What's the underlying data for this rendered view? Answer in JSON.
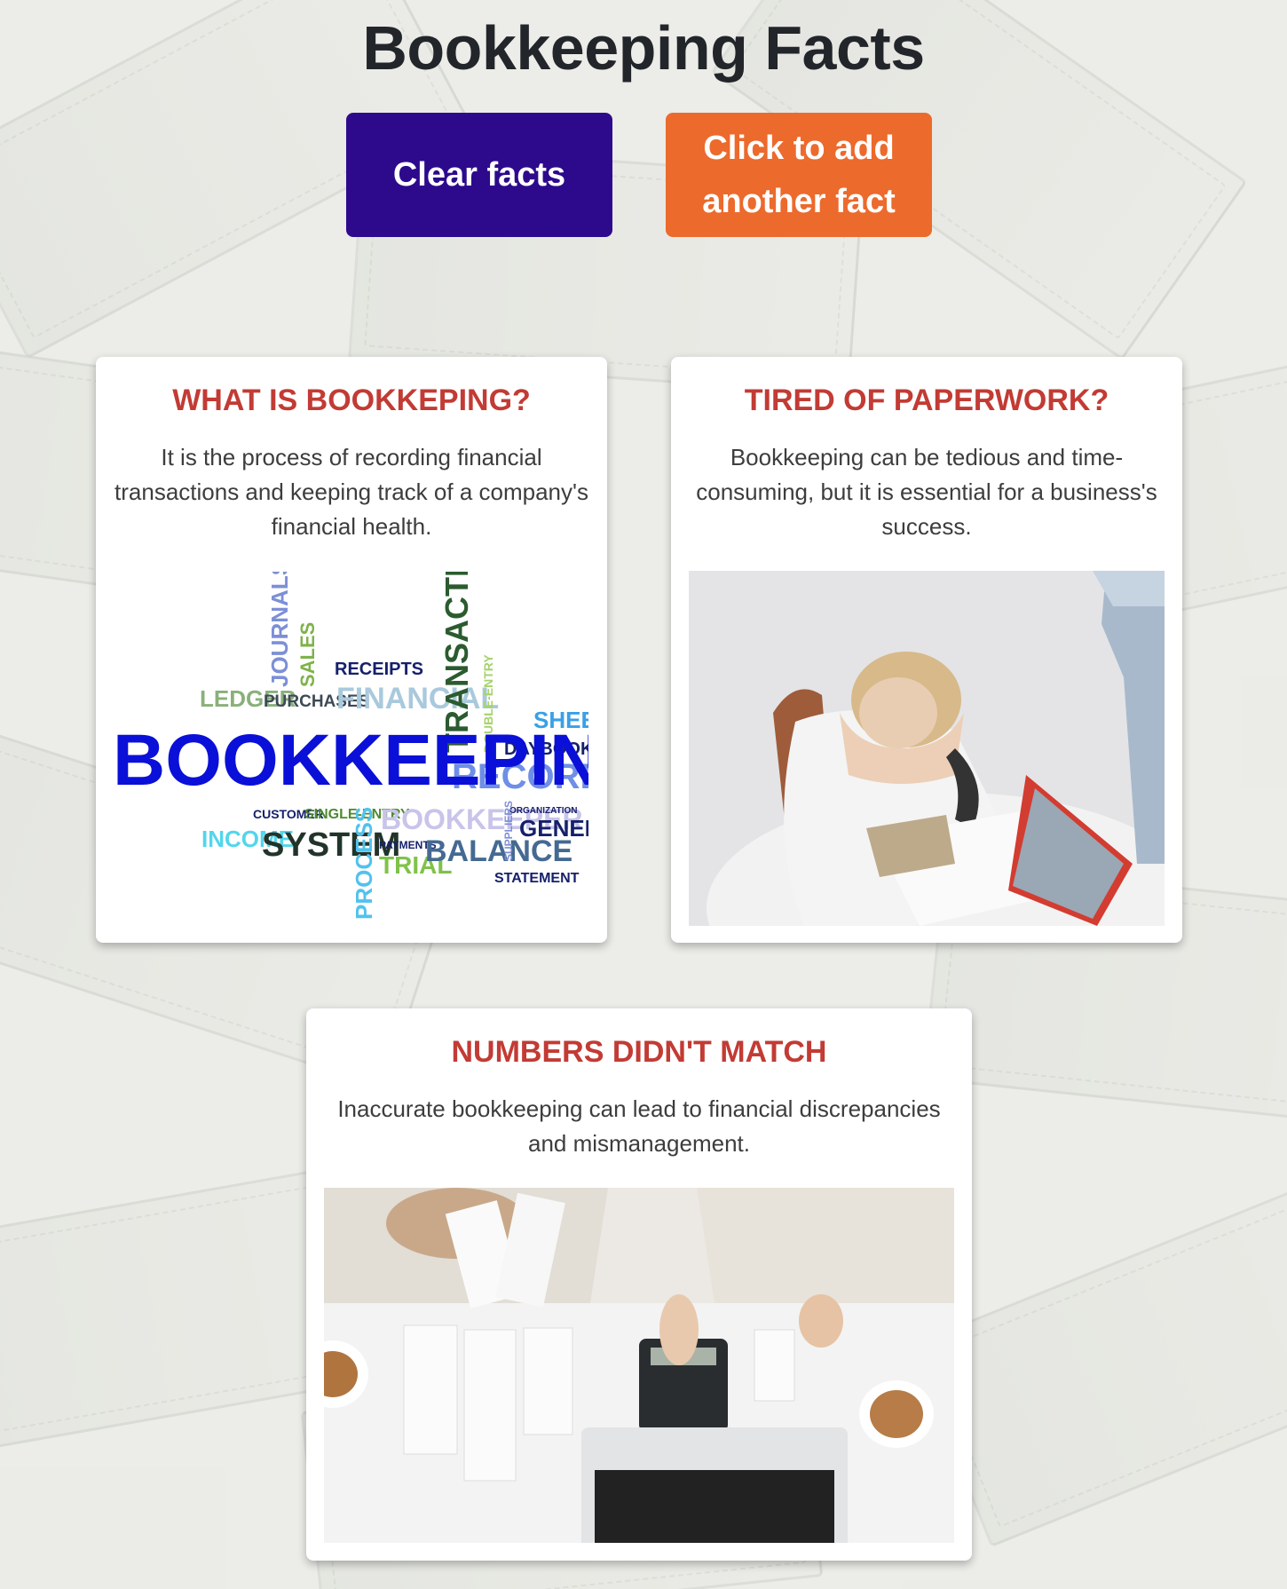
{
  "header": {
    "title": "Bookkeeping Facts"
  },
  "buttons": {
    "clear_label": "Clear facts",
    "add_label": "Click to add another fact"
  },
  "facts": [
    {
      "title": "WHAT IS BOOKKEPING?",
      "text": "It is the process of recording financial transactions and keeping track of a company's financial health.",
      "image": "word-cloud"
    },
    {
      "title": "TIRED OF PAPERWORK?",
      "text": "Bookkeeping can be tedious and time-consuming, but it is essential for a business's success.",
      "image": "stressed-person-photo"
    },
    {
      "title": "NUMBERS DIDN'T MATCH",
      "text": "Inaccurate bookkeeping can lead to financial discrepancies and mismanagement.",
      "image": "receipts-calculator-photo"
    }
  ],
  "wordcloud": {
    "main": "BOOKKEEPING",
    "words": [
      "JOURNALS",
      "SALES",
      "RECEIPTS",
      "LEDGER",
      "PURCHASES",
      "FINANCIAL",
      "TRANSACTION",
      "DOUBLE-ENTRY",
      "SHEET",
      "DAYBOOK",
      "RECORDING",
      "CUSTOMER",
      "SINGLE-ENTRY",
      "BOOKKEEPER",
      "ORGANIZATION",
      "GENERAL",
      "INCOME",
      "SYSTEM",
      "PROCESS",
      "PAYMENTS",
      "TRIAL",
      "BALANCE",
      "SUPPLIERS",
      "STATEMENT"
    ]
  },
  "colors": {
    "title": "#22252a",
    "clear_button": "#2d0a8c",
    "add_button": "#ec6a2c",
    "card_heading": "#c23b34"
  }
}
